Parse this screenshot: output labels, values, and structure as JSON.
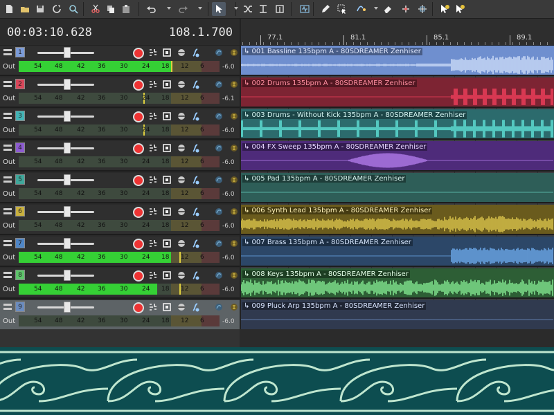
{
  "colors": {
    "toolbar_bg": "#3a3a3a",
    "meter_green": "#35d035",
    "border_teal": "#0d4d50",
    "border_mint": "#bfe6cf"
  },
  "toolbar": {
    "icons": [
      "new-file-icon",
      "open-folder-icon",
      "save-icon",
      "refresh-icon",
      "search-zoom-icon",
      "cut-icon",
      "copy-icon",
      "paste-icon",
      "undo-icon",
      "redo-icon",
      "select-cursor-icon",
      "shuffle-icon",
      "trim-icon",
      "split-icon",
      "waveform-icon",
      "pencil-icon",
      "selection-icon",
      "envelope-icon",
      "eraser-icon",
      "snap-icon",
      "fade-icon",
      "help-icon",
      "whats-this-icon"
    ]
  },
  "transport": {
    "time": "00:03:10.628",
    "beats": "108.1.700"
  },
  "ruler": {
    "markers": [
      "77.1",
      "81.1",
      "85.1",
      "89.1"
    ]
  },
  "meter": {
    "out_label": "Out",
    "scale": [
      "54",
      "48",
      "42",
      "36",
      "30",
      "24",
      "18",
      "12",
      "6"
    ]
  },
  "tracks": [
    {
      "num": "1",
      "color": "#7b9bd8",
      "db": "-6.0",
      "level": 0.76,
      "peak": 0.76,
      "lane_color": "#6f8fcf",
      "wave_color": "#c8d8f5",
      "clip": "001 Bassline 135bpm A - 80SDREAMER Zenhiser",
      "title_color": "#e0e8ff"
    },
    {
      "num": "2",
      "color": "#d9475a",
      "db": "-6.1",
      "level": 0,
      "peak": 0.62,
      "lane_color": "#7d2433",
      "wave_color": "#ef3d5a",
      "clip": "002 Drums 135bpm A - 80SDREAMER Zenhiser",
      "title_color": "#ff8ea0"
    },
    {
      "num": "3",
      "color": "#43b4b6",
      "db": "-6.0",
      "level": 0,
      "peak": 0.62,
      "lane_color": "#2c6b6d",
      "wave_color": "#5ee0d6",
      "clip": "003 Drums - Without Kick 135bpm A - 80SDREAMER Zenhiser",
      "title_color": "#d4f5f2"
    },
    {
      "num": "4",
      "color": "#8d5bd1",
      "db": "-6.0",
      "level": 0,
      "peak": 0,
      "lane_color": "#4e2b7a",
      "wave_color": "#b07ae8",
      "clip": "004 FX Sweep 135bpm A - 80SDREAMER Zenhiser",
      "title_color": "#e5d4ff"
    },
    {
      "num": "5",
      "color": "#40a79b",
      "db": "-6.0",
      "level": 0,
      "peak": 0,
      "lane_color": "#2e5e58",
      "wave_color": "#61c6b6",
      "clip": "005 Pad 135bpm A - 80SDREAMER Zenhiser",
      "title_color": "#d8f3ee"
    },
    {
      "num": "6",
      "color": "#c9b13f",
      "db": "-6.0",
      "level": 0,
      "peak": 0,
      "lane_color": "#6a5b1d",
      "wave_color": "#d6c04a",
      "clip": "006 Synth Lead 135bpm A - 80SDREAMER Zenhiser",
      "title_color": "#fff2b8"
    },
    {
      "num": "7",
      "color": "#4f86c6",
      "db": "-6.0",
      "level": 0.76,
      "peak": 0.8,
      "lane_color": "#2c4768",
      "wave_color": "#6aa6e6",
      "clip": "007 Brass 135bpm A - 80SDREAMER Zenhiser",
      "title_color": "#d8e8ff"
    },
    {
      "num": "8",
      "color": "#5ec46b",
      "db": "-6.0",
      "level": 0.69,
      "peak": 0.8,
      "lane_color": "#2d5e35",
      "wave_color": "#7fe08c",
      "clip": "008 Keys 135bpm A - 80SDREAMER Zenhiser",
      "title_color": "#e4ffe8"
    },
    {
      "num": "9",
      "color": "#6b8cbf",
      "db": "-6.0",
      "level": 0,
      "peak": 0,
      "lane_color": "#303a4f",
      "wave_color": "#6b8cbf",
      "clip": "009 Pluck Arp 135bpm A - 80SDREAMER Zenhiser",
      "title_color": "#d8e4ff"
    }
  ]
}
